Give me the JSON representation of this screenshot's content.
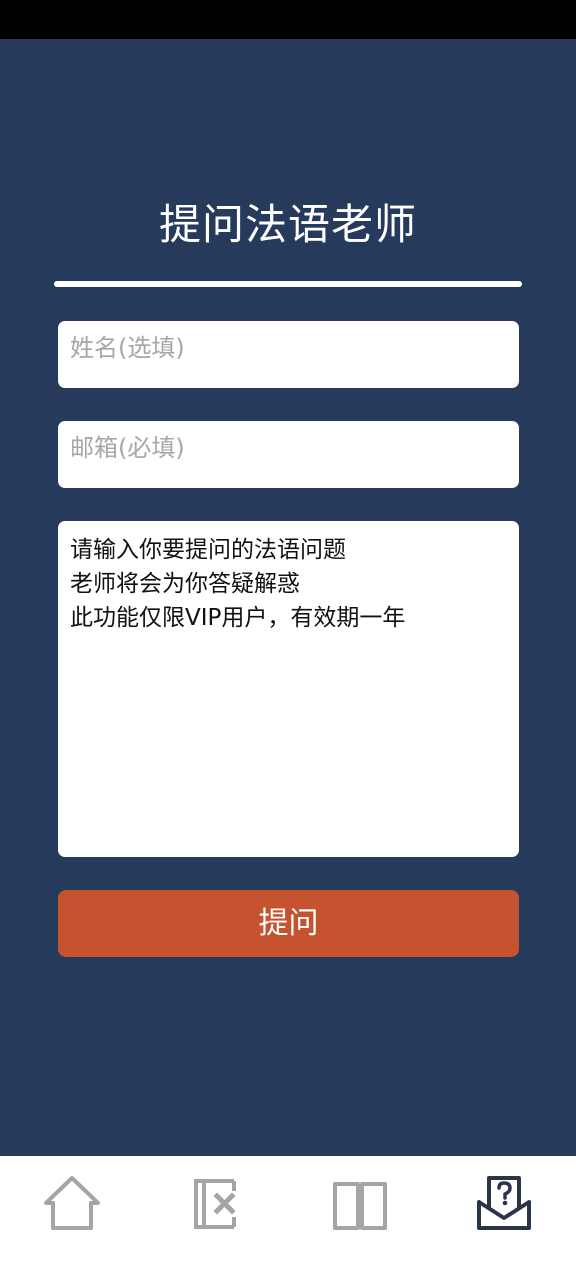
{
  "page": {
    "title": "提问法语老师"
  },
  "form": {
    "name_placeholder": "姓名(选填)",
    "email_placeholder": "邮箱(必填)",
    "question_lines": [
      "请输入你要提问的法语问题",
      "老师将会为你答疑解惑",
      "此功能仅限VIP用户，有效期一年"
    ],
    "submit_label": "提问"
  },
  "nav": {
    "items": [
      {
        "icon": "home-icon",
        "active": false
      },
      {
        "icon": "flashcard-delete-icon",
        "active": false
      },
      {
        "icon": "book-icon",
        "active": false
      },
      {
        "icon": "question-inbox-icon",
        "active": true
      }
    ]
  },
  "colors": {
    "background": "#263a5c",
    "accent": "#c65330",
    "nav_inactive": "#a5a5a5",
    "nav_active": "#2a3648"
  }
}
